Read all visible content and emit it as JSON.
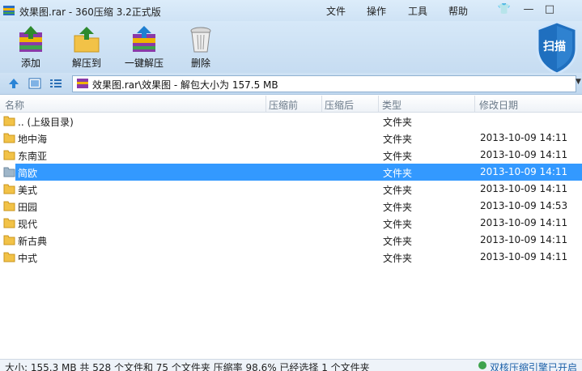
{
  "window": {
    "title": "效果图.rar - 360压缩 3.2正式版"
  },
  "menu": {
    "file": "文件",
    "ops": "操作",
    "tools": "工具",
    "help": "帮助"
  },
  "window_controls": {
    "skin": "👕",
    "minimize": "—",
    "maximize": "□"
  },
  "toolbar": {
    "add": "添加",
    "extract_to": "解压到",
    "one_click": "一键解压",
    "delete": "删除"
  },
  "scan": {
    "label": "扫描"
  },
  "address": {
    "path": "效果图.rar\\效果图 - 解包大小为 157.5 MB"
  },
  "columns": {
    "name": "名称",
    "compressed": "压缩前",
    "compressed_after": "压缩后",
    "type": "类型",
    "modified": "修改日期"
  },
  "files": [
    {
      "name": ".. (上级目录)",
      "type": "文件夹",
      "date": ""
    },
    {
      "name": "地中海",
      "type": "文件夹",
      "date": "2013-10-09 14:11"
    },
    {
      "name": "东南亚",
      "type": "文件夹",
      "date": "2013-10-09 14:11"
    },
    {
      "name": "简欧",
      "type": "文件夹",
      "date": "2013-10-09 14:11"
    },
    {
      "name": "美式",
      "type": "文件夹",
      "date": "2013-10-09 14:11"
    },
    {
      "name": "田园",
      "type": "文件夹",
      "date": "2013-10-09 14:53"
    },
    {
      "name": "现代",
      "type": "文件夹",
      "date": "2013-10-09 14:11"
    },
    {
      "name": "新古典",
      "type": "文件夹",
      "date": "2013-10-09 14:11"
    },
    {
      "name": "中式",
      "type": "文件夹",
      "date": "2013-10-09 14:11"
    }
  ],
  "status": {
    "summary": "大小: 155.3 MB 共 528 个文件和 75 个文件夹 压缩率 98.6% 已经选择 1 个文件夹",
    "engine": "双核压缩引擎已开启"
  },
  "colors": {
    "selection": "#3399ff",
    "toolbar": "#c6dcf1"
  }
}
